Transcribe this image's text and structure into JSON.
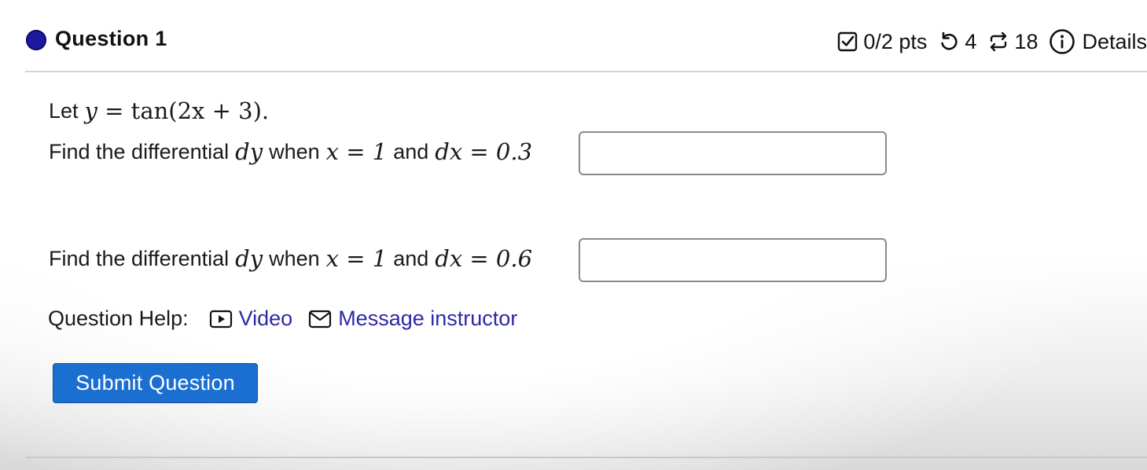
{
  "question": {
    "title": "Question 1",
    "points": "0/2 pts",
    "attempts": "4",
    "versions": "18",
    "details_label": "Details"
  },
  "prompt": {
    "intro_text": "Let",
    "intro_math_lhs": "y",
    "intro_math_rhs": "= tan(2x + 3).",
    "part1": {
      "text_find": "Find the differential",
      "dy": "dy",
      "text_when": "when",
      "x_eq": "x = 1",
      "text_and": "and",
      "dx_eq": "dx = 0.3",
      "answer_value": ""
    },
    "part2": {
      "text_find": "Find the differential",
      "dy": "dy",
      "text_when": "when",
      "x_eq": "x = 1",
      "text_and": "and",
      "dx_eq": "dx = 0.6",
      "answer_value": ""
    }
  },
  "help": {
    "label": "Question Help:",
    "video_label": "Video",
    "message_label": "Message instructor"
  },
  "submit_label": "Submit Question",
  "icons": {
    "status_dot": "filled-circle",
    "points": "checkbox-icon",
    "attempts": "undo-icon",
    "versions": "repeat-icon",
    "details": "info-icon",
    "video": "play-icon",
    "message": "envelope-icon"
  },
  "colors": {
    "status_dot": "#1c1a9c",
    "link": "#2e27a6",
    "submit_bg": "#1a6fd1"
  }
}
